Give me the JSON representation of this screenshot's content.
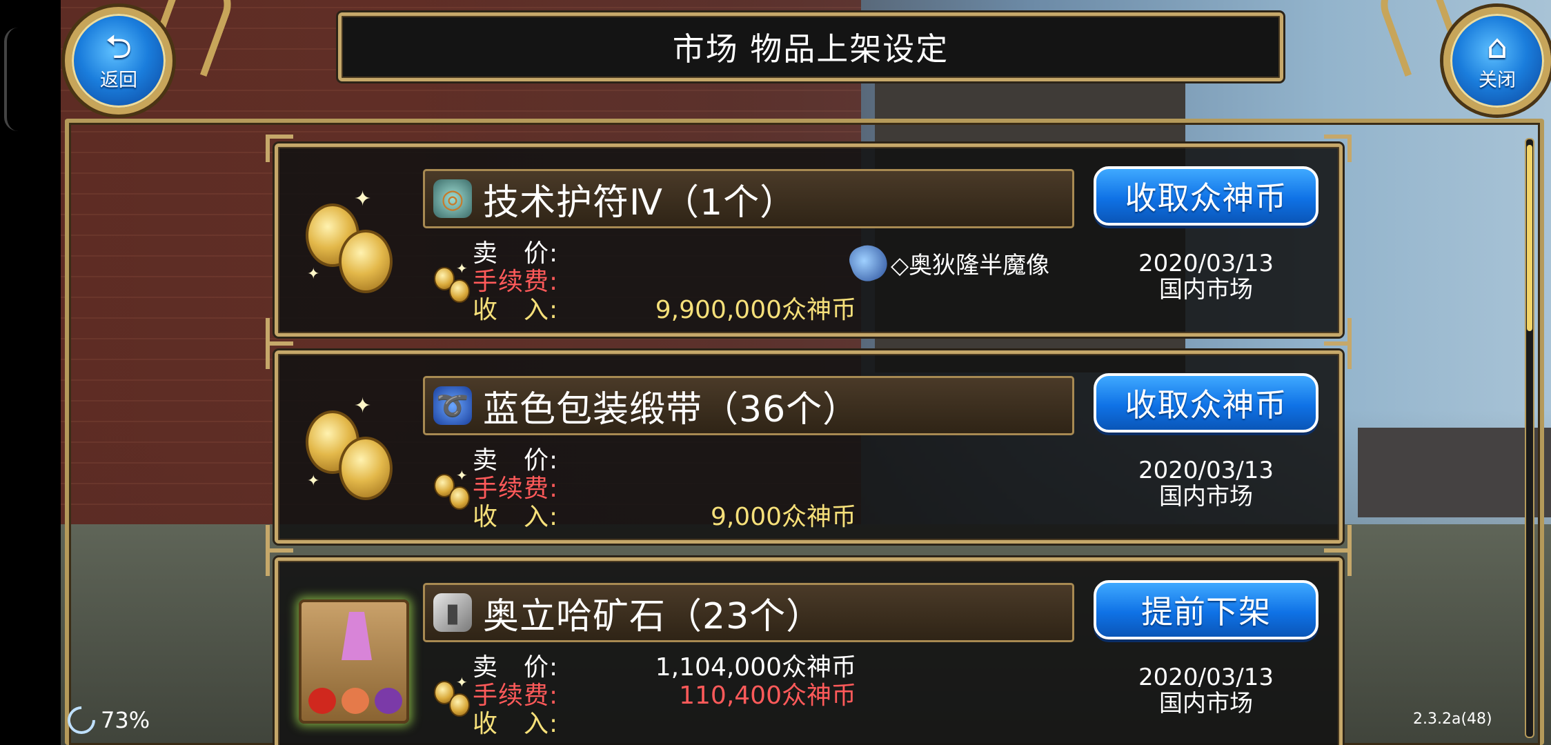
{
  "header": {
    "title": "市场 物品上架设定",
    "back_label": "返回",
    "back_icon": "back-arrow-icon",
    "close_label": "关闭",
    "close_icon": "home-icon"
  },
  "field_labels": {
    "sell": "卖　价:",
    "fee": "手续费:",
    "income": "收　入:"
  },
  "listings": [
    {
      "item_name": "技术护符Ⅳ（1个）",
      "item_icon": "amulet-icon",
      "action_label": "收取众神币",
      "sell_price": "",
      "fee": "",
      "income": "9,900,000众神币",
      "buyer": "◇奥狄隆半魔像",
      "date": "2020/03/13",
      "market": "国内市场",
      "status_icon": "coins-icon"
    },
    {
      "item_name": "蓝色包装缎带（36个）",
      "item_icon": "ribbon-icon",
      "action_label": "收取众神币",
      "sell_price": "",
      "fee": "",
      "income": "9,000众神币",
      "buyer": "",
      "date": "2020/03/13",
      "market": "国内市场",
      "status_icon": "coins-icon"
    },
    {
      "item_name": "奥立哈矿石（23个）",
      "item_icon": "ore-icon",
      "action_label": "提前下架",
      "sell_price": "1,104,000众神币",
      "fee": "110,400众神币",
      "income": "",
      "buyer": "",
      "date": "2020/03/13",
      "market": "国内市场",
      "status_icon": "market-stall-icon"
    }
  ],
  "status": {
    "signal": "73%",
    "version": "2.3.2a(48)"
  },
  "colors": {
    "gold_frame": "#c6a86a",
    "button_blue": "#0f72e6",
    "fee_red": "#ff5a5a",
    "income_yellow": "#f6e07a"
  }
}
